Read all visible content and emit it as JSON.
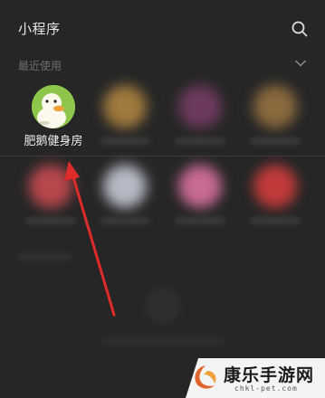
{
  "header": {
    "title": "小程序",
    "search_icon": "search-icon"
  },
  "recent": {
    "label": "最近使用",
    "collapse_icon": "chevron-down-icon",
    "app": {
      "name": "肥鹅健身房",
      "icon": "goose-avatar-icon"
    }
  },
  "watermark": {
    "title": "康乐手游网",
    "subtitle": "chkl-pet.com"
  },
  "colors": {
    "background": "#262626",
    "arrow": "#e02b2b",
    "app_icon_bg": "#8ec64b"
  }
}
